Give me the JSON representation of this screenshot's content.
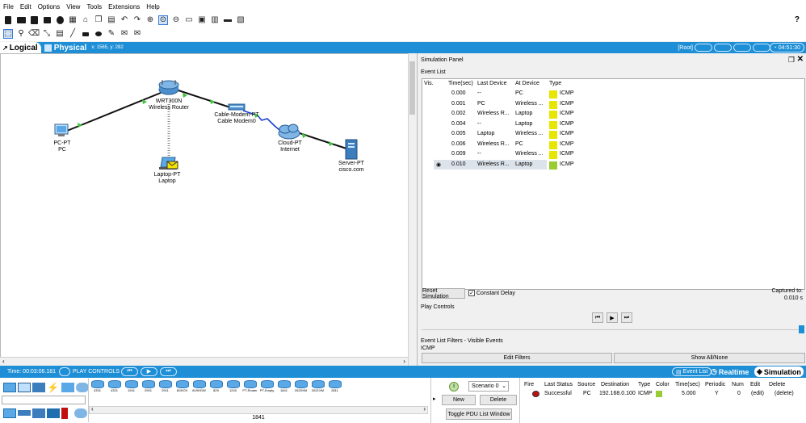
{
  "menu": [
    "File",
    "Edit",
    "Options",
    "View",
    "Tools",
    "Extensions",
    "Help"
  ],
  "help_glyph": "?",
  "tabs": {
    "logical": "Logical",
    "physical": "Physical"
  },
  "coords_text": "x: 1565, y: 282",
  "root_label": "[Root]",
  "clock": "04:51:30",
  "devices": {
    "router": {
      "line1": "WRT300N",
      "line2": "Wireless Router"
    },
    "modem": {
      "line1": "Cable-Modem-PT",
      "line2": "Cable Modem0"
    },
    "cloud": {
      "line1": "Cloud-PT",
      "line2": "Internet"
    },
    "server": {
      "line1": "Server-PT",
      "line2": "cisco.com"
    },
    "pc": {
      "line1": "PC-PT",
      "line2": "PC"
    },
    "laptop": {
      "line1": "Laptop-PT",
      "line2": "Laptop"
    }
  },
  "sim": {
    "title": "Simulation Panel",
    "event_list_label": "Event List",
    "columns": [
      "Vis.",
      "Time(sec)",
      "Last Device",
      "At Device",
      "Type"
    ],
    "events": [
      {
        "time": "0.000",
        "last": "--",
        "at": "PC",
        "type": "ICMP",
        "color": "#e6e600"
      },
      {
        "time": "0.001",
        "last": "PC",
        "at": "Wireless ...",
        "type": "ICMP",
        "color": "#e6e600"
      },
      {
        "time": "0.002",
        "last": "Wireless R...",
        "at": "Laptop",
        "type": "ICMP",
        "color": "#e6e600"
      },
      {
        "time": "0.004",
        "last": "--",
        "at": "Laptop",
        "type": "ICMP",
        "color": "#e6e600"
      },
      {
        "time": "0.005",
        "last": "Laptop",
        "at": "Wireless ...",
        "type": "ICMP",
        "color": "#e6e600"
      },
      {
        "time": "0.006",
        "last": "Wireless R...",
        "at": "PC",
        "type": "ICMP",
        "color": "#e6e600"
      },
      {
        "time": "0.009",
        "last": "--",
        "at": "Wireless ...",
        "type": "ICMP",
        "color": "#e6e600"
      },
      {
        "time": "0.010",
        "last": "Wireless R...",
        "at": "Laptop",
        "type": "ICMP",
        "color": "#99cc33"
      }
    ],
    "reset_button": "Reset Simulation",
    "constant_delay": "Constant Delay",
    "captured_label": "Captured to:",
    "captured_value": "0.010 s",
    "play_controls_label": "Play Controls",
    "filters_label": "Event List Filters - Visible Events",
    "filters_value": "ICMP",
    "edit_filters": "Edit Filters",
    "show_all": "Show All/None"
  },
  "bottom": {
    "time": "Time: 00:03:06.181",
    "play_controls": "PLAY CONTROLS",
    "event_list_button": "Event List",
    "realtime": "Realtime",
    "simulation": "Simulation",
    "models": [
      "4331",
      "4321",
      "1941",
      "2901",
      "2911",
      "819IOX",
      "819HGW",
      "829",
      "1240",
      "PT-Router",
      "PT-Empty",
      "1841",
      "2620XM",
      "2621XM",
      "2811"
    ],
    "selected_model": "1841",
    "scenario": "Scenario 0",
    "new_button": "New",
    "delete_button": "Delete",
    "toggle_pdu": "Toggle PDU List Window",
    "pdu_columns": [
      "Fire",
      "Last Status",
      "Source",
      "Destination",
      "Type",
      "Color",
      "Time(sec)",
      "Periodic",
      "Num",
      "Edit",
      "Delete"
    ],
    "pdu_row": {
      "status": "Successful",
      "source": "PC",
      "destination": "192.168.0.100",
      "type": "ICMP",
      "color": "#99cc33",
      "time": "5.000",
      "periodic": "Y",
      "num": "0",
      "edit": "(edit)",
      "delete": "(delete)"
    }
  }
}
